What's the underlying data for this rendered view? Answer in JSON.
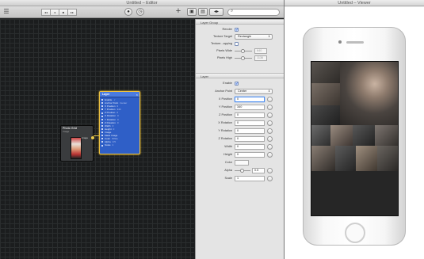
{
  "editor": {
    "title": "Untitled – Editor",
    "toolbar": {
      "add": "+",
      "segments": [
        "◂◂",
        "◂",
        "■",
        "▸▸"
      ]
    },
    "patches": {
      "photo_grid": {
        "title": "Photo Grid",
        "subtitle": "Image",
        "port": "Image"
      },
      "layer": {
        "title": "Layer",
        "close": "×",
        "ports": [
          {
            "name": "Enable",
            "value": "✓"
          },
          {
            "name": "Anchor Point",
            "value": "Center"
          },
          {
            "name": "X Position",
            "value": "0"
          },
          {
            "name": "Y Position",
            "value": "340"
          },
          {
            "name": "Z Position",
            "value": "0"
          },
          {
            "name": "X Rotation",
            "value": "0"
          },
          {
            "name": "Y Rotation",
            "value": "0"
          },
          {
            "name": "Z Rotation",
            "value": "0"
          },
          {
            "name": "Width",
            "value": "0"
          },
          {
            "name": "Height",
            "value": "0"
          },
          {
            "name": "Image",
            "value": ""
          },
          {
            "name": "Mask Image",
            "value": ""
          },
          {
            "name": "Color",
            "value": "White"
          },
          {
            "name": "Alpha",
            "value": "0.5"
          },
          {
            "name": "Scale",
            "value": "1"
          }
        ]
      }
    }
  },
  "inspector": {
    "layer_group": {
      "title": "Layer Group",
      "render_label": "Render",
      "texture_target_label": "Texture Target",
      "texture_target_value": "Rectangle",
      "texture_mapping_label": "Texture...apping",
      "pixels_wide_label": "Pixels Wide",
      "pixels_wide_value": "640",
      "pixels_high_label": "Pixels High",
      "pixels_high_value": "1136"
    },
    "layer": {
      "title": "Layer",
      "rows": [
        {
          "label": "Enable",
          "kind": "checkbox",
          "value": "✓"
        },
        {
          "label": "Anchor Point",
          "kind": "select",
          "value": "Center"
        },
        {
          "label": "X Position",
          "kind": "field",
          "value": "0"
        },
        {
          "label": "Y Position",
          "kind": "field",
          "value": "340"
        },
        {
          "label": "Z Position",
          "kind": "field",
          "value": "0"
        },
        {
          "label": "X Rotation",
          "kind": "field",
          "value": "0"
        },
        {
          "label": "Y Rotation",
          "kind": "field",
          "value": "0"
        },
        {
          "label": "Z Rotation",
          "kind": "field",
          "value": "0"
        },
        {
          "label": "Width",
          "kind": "field",
          "value": "0"
        },
        {
          "label": "Height",
          "kind": "field",
          "value": "0"
        },
        {
          "label": "Color",
          "kind": "swatch",
          "value": ""
        },
        {
          "label": "Alpha",
          "kind": "slider",
          "value": "0.5"
        },
        {
          "label": "Scale",
          "kind": "field",
          "value": "1"
        }
      ]
    }
  },
  "viewer": {
    "title": "Untitled – Viewer"
  },
  "colors": {
    "layer_patch": "#2f5fc7",
    "selection_outline": "#f0c23a",
    "graph_bg": "#1b1d1e"
  }
}
